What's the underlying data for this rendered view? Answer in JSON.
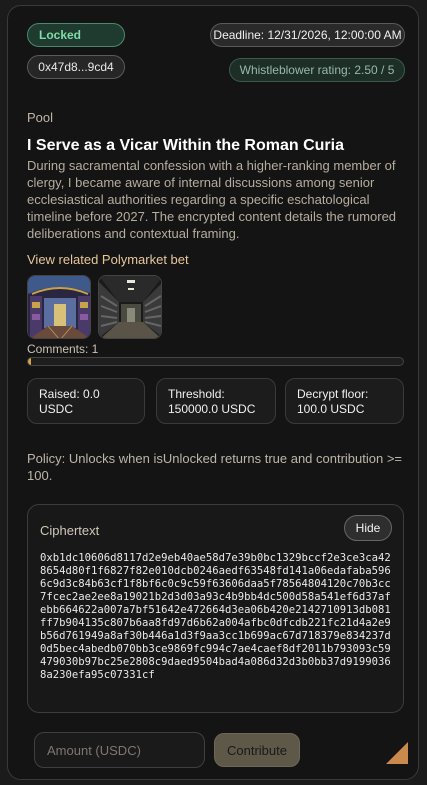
{
  "header": {
    "status": "Locked",
    "address": "0x47d8...9cd4",
    "deadline": "Deadline: 12/31/2026, 12:00:00 AM",
    "rating": "Whistleblower rating: 2.50 / 5"
  },
  "pool": {
    "label": "Pool",
    "title": "I Serve as a Vicar Within the Roman Curia",
    "description": "During sacramental confession with a higher-ranking member of clergy, I became aware of internal discussions among senior ecclesiastical authorities regarding a specific eschatological timeline before 2027. The encrypted content details the rumored deliberations and contextual framing.",
    "bet_link": "View related Polymarket bet"
  },
  "comments": {
    "label": "Comments: 1",
    "progress_fraction": 0.008
  },
  "stats": {
    "raised_label": "Raised: 0.0",
    "raised_unit": "USDC",
    "threshold_label": "Threshold:",
    "threshold_value": "150000.0 USDC",
    "floor_label": "Decrypt floor:",
    "floor_value": "100.0 USDC"
  },
  "policy": "Policy: Unlocks when isUnlocked returns true and contribution >= 100.",
  "ciphertext": {
    "label": "Ciphertext",
    "hide_label": "Hide",
    "value": "0xb1dc10606d8117d2e9eb40ae58d7e39b0bc1329bccf2e3ce3ca428654d80f1f6827f82e010dcb0246aedf63548fd141a06edafaba5966c9d3c84b63cf1f8bf6c0c9c59f63606daa5f78564804120c70b3cc7fcec2ae2ee8a19021b2d3d03a93c4b9bb4dc500d58a541ef6d37afebb664622a007a7bf51642e472664d3ea06b420e2142710913db081ff7b904135c807b6aa8fd97d6b62a004afbc0dfcdb221fc21d4a2e9b56d761949a8af30b446a1d3f9aa3cc1b699ac67d718379e834237d0d5bec4abedb070bb3ce9869fc994c7ae4caef8df2011b793093c59479030b97bc25e2808c9daed9504bad4a086d32d3b0bb37d91990368a230efa95c07331cf"
  },
  "contribute": {
    "amount_placeholder": "Amount (USDC)",
    "button_label": "Contribute"
  },
  "colors": {
    "accent_gold": "#d9a441",
    "status_green": "#7fdca8",
    "resize_handle": "#c98a4c"
  }
}
